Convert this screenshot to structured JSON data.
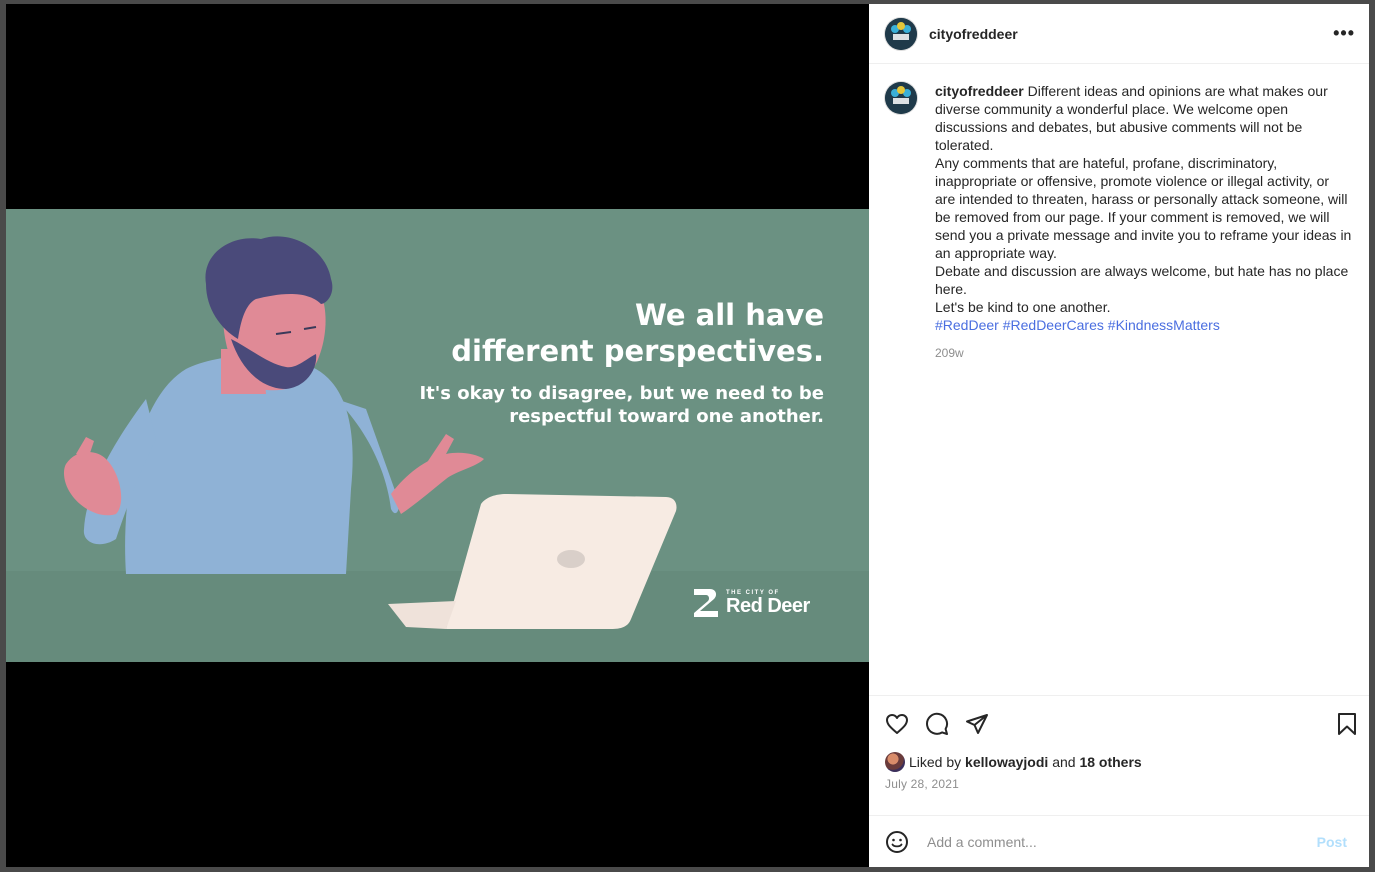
{
  "post": {
    "username": "cityofreddeer",
    "caption_username": "cityofreddeer",
    "caption_lines": [
      "Different ideas and opinions are what makes our diverse community a wonderful place. We welcome open discussions and debates, but abusive comments will not be tolerated.",
      "Any comments that are hateful, profane, discriminatory, inappropriate or offensive, promote violence or illegal activity, or are intended to threaten, harass or personally attack someone, will be removed from our page. If your comment is removed, we will send you a private message and invite you to reframe your ideas in an appropriate way.",
      "Debate and discussion are always welcome, but hate has no place here.",
      "Let's be kind to one another."
    ],
    "hashtags": [
      "#RedDeer",
      "#RedDeerCares",
      "#KindnessMatters"
    ],
    "age": "209w",
    "liked_by_prefix": "Liked by",
    "liked_by_user": "kellowayjodi",
    "liked_by_and": "and",
    "liked_by_others": "18 others",
    "date": "July 28, 2021"
  },
  "media": {
    "headline_line1": "We all have",
    "headline_line2": "different perspectives.",
    "sub_line1": "It's okay to disagree, but we need to be",
    "sub_line2": "respectful toward one another.",
    "logo_small": "THE CITY OF",
    "logo_big": "Red Deer"
  },
  "comment": {
    "placeholder": "Add a comment...",
    "post_label": "Post"
  },
  "icons": {
    "more": "more-options-icon",
    "like": "heart-icon",
    "comment": "comment-icon",
    "share": "share-icon",
    "save": "bookmark-icon",
    "emoji": "emoji-icon"
  },
  "colors": {
    "hashtag": "#4a6ee0",
    "art_background": "#6b9182",
    "post_button": "#b2dffc"
  }
}
